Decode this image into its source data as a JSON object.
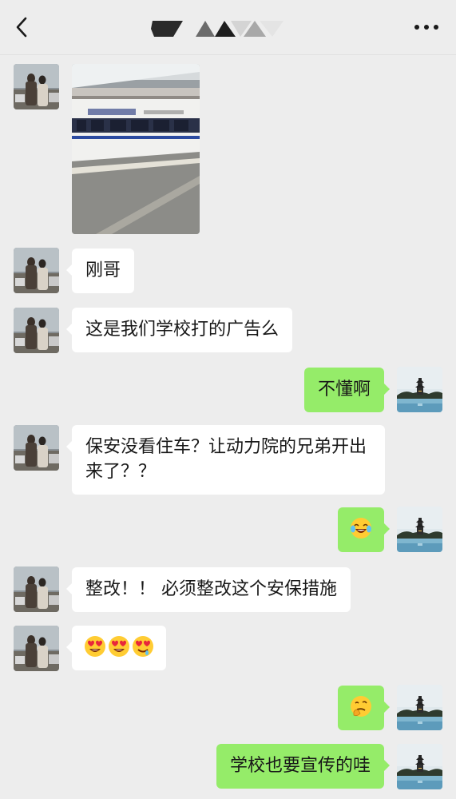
{
  "header": {
    "back_icon": "chevron-left-icon",
    "more_icon": "more-dots-icon",
    "title_obscured": true
  },
  "messages": [
    {
      "side": "in",
      "type": "image",
      "image_desc": "train-photo"
    },
    {
      "side": "in",
      "type": "text",
      "text": "刚哥"
    },
    {
      "side": "in",
      "type": "text",
      "text": "这是我们学校打的广告么"
    },
    {
      "side": "out",
      "type": "text",
      "text": "不懂啊"
    },
    {
      "side": "in",
      "type": "text",
      "text": "保安没看住车？让动力院的兄弟开出来了？？"
    },
    {
      "side": "out",
      "type": "emoji",
      "emoji": [
        "crying-laughing-emoji"
      ]
    },
    {
      "side": "in",
      "type": "text",
      "text": "整改！！ 必须整改这个安保措施"
    },
    {
      "side": "in",
      "type": "emoji",
      "emoji": [
        "heart-eyes-emoji",
        "heart-eyes-emoji",
        "heart-eyes-drool-emoji"
      ]
    },
    {
      "side": "out",
      "type": "emoji",
      "emoji": [
        "thinking-smirk-emoji"
      ]
    },
    {
      "side": "out",
      "type": "text",
      "text": "学校也要宣传的哇"
    }
  ],
  "colors": {
    "background": "#ededed",
    "outgoing_bubble": "#95ec69",
    "incoming_bubble": "#ffffff"
  }
}
